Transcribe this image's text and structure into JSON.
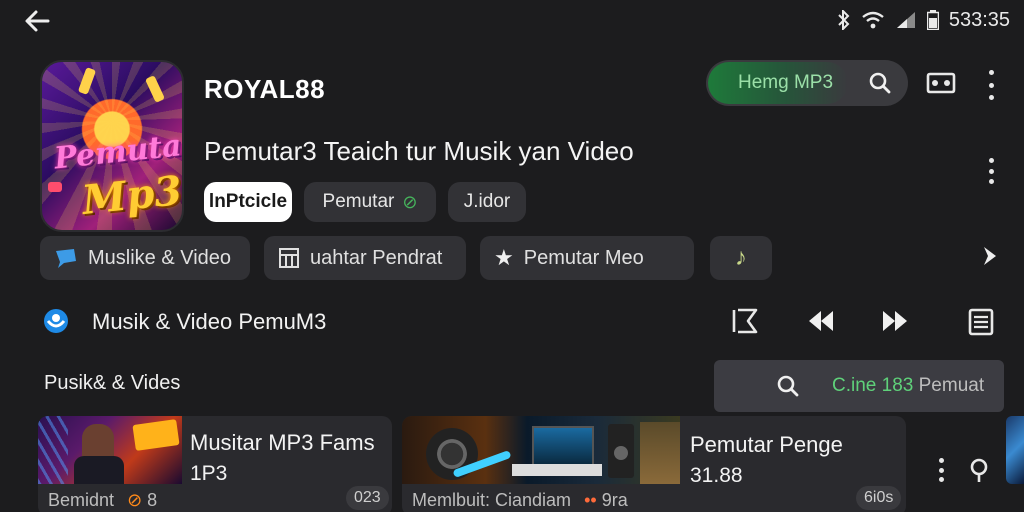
{
  "status": {
    "time": "533:35"
  },
  "app": {
    "icon_line1": "Pemutar",
    "icon_line2": "Mp3",
    "brand": "ROYAL88",
    "subtitle": "Pemutar3 Teaich tur Musik yan Video"
  },
  "search_pill": {
    "label": "Hemg MP3"
  },
  "chips": [
    {
      "label": "lnPtcicle",
      "active": true
    },
    {
      "label": "Pemutar",
      "active": false
    },
    {
      "label": "J.idor",
      "active": false
    }
  ],
  "chips2": [
    {
      "label": "Muslike & Video",
      "icon": "chat-bubble-icon"
    },
    {
      "label": "uahtar Pendrat",
      "icon": "grid-icon"
    },
    {
      "label": "Pemutar Meo",
      "icon": "star-icon"
    },
    {
      "label": "",
      "icon": "music-note-icon"
    }
  ],
  "section": {
    "title": "Musik & Video PemuM3"
  },
  "sub_label": "Pusik& & Vides",
  "search_box": {
    "green_text": "C.ine 183",
    "gray_text": "Pemuat"
  },
  "cards": [
    {
      "title": "Musitar MP3 Fams",
      "subtitle": "1P3",
      "meta": "Bemidnt",
      "meta_num": "8",
      "badge": "023"
    },
    {
      "title": "Pemutar Penge",
      "subtitle": "31.88",
      "meta": "Memlbuit: Ciandiam",
      "meta_num": "9ra",
      "badge": "6i0s"
    }
  ],
  "colors": {
    "accent_green": "#1e7a3a",
    "background": "#1c1c1e",
    "chip": "#323236"
  }
}
